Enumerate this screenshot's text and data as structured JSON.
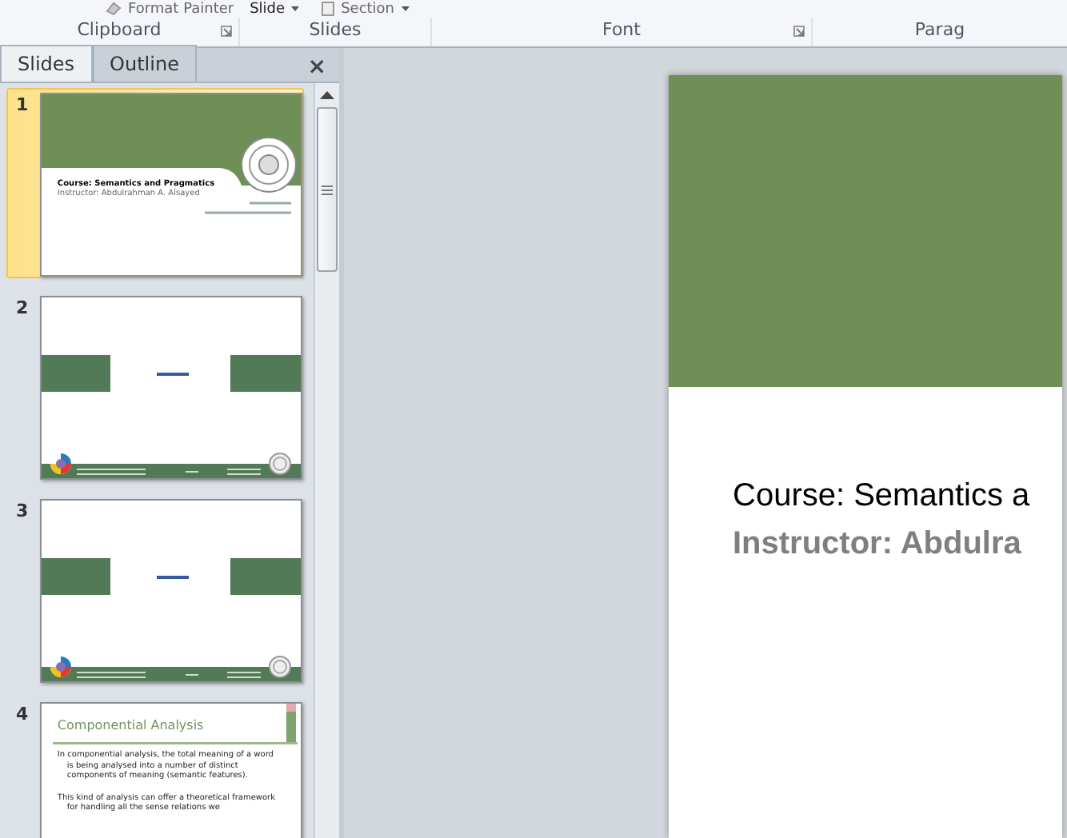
{
  "ribbon": {
    "top_items": [
      {
        "label": "Format Painter",
        "kind": "painter"
      },
      {
        "label": "Slide",
        "kind": "dropdown"
      },
      {
        "label": "Section",
        "kind": "section"
      }
    ],
    "groups": [
      {
        "label": "Clipboard",
        "launcher": true
      },
      {
        "label": "Slides",
        "launcher": false
      },
      {
        "label": "Font",
        "launcher": true
      },
      {
        "label": "Parag"
      }
    ]
  },
  "panel": {
    "tabs": [
      {
        "label": "Slides",
        "selected": true
      },
      {
        "label": "Outline",
        "selected": false
      }
    ],
    "close": "×",
    "slides": [
      {
        "number": "1",
        "selected": true,
        "kind": "title",
        "course": "Course: Semantics and Pragmatics",
        "instructor": "Instructor: Abdulrahman A. Alsayed"
      },
      {
        "number": "2",
        "selected": false,
        "kind": "section"
      },
      {
        "number": "3",
        "selected": false,
        "kind": "section"
      },
      {
        "number": "4",
        "selected": false,
        "kind": "content",
        "title": "Componential Analysis",
        "paragraphs": [
          "In componential analysis, the total meaning of a word is being analysed into a number of distinct components of meaning (semantic features).",
          "This kind of analysis can offer a theoretical framework for handling all the sense relations we"
        ]
      }
    ]
  },
  "main_slide": {
    "course": "Course: Semantics  a",
    "instructor": "Instructor: Abdulra"
  }
}
